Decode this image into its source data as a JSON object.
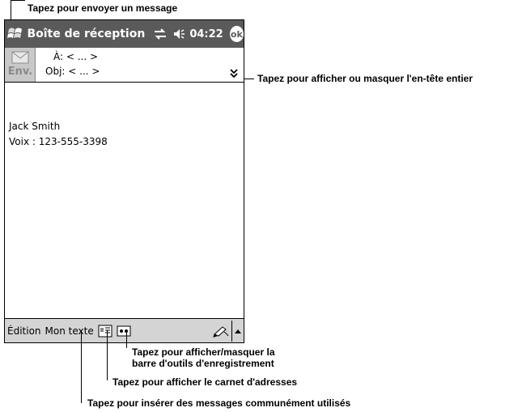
{
  "callouts": {
    "send": "Tapez pour envoyer un message",
    "header_toggle": "Tapez pour afficher ou masquer l'en-tête entier",
    "recording_line1": "Tapez pour afficher/masquer la",
    "recording_line2": "barre d'outils d'enregistrement",
    "address_book": "Tapez pour afficher le carnet d'adresses",
    "my_text": "Tapez pour insérer des messages communément utilisés"
  },
  "titlebar": {
    "title": "Boîte de réception",
    "time": "04:22",
    "ok_label": "ok"
  },
  "header": {
    "send_label": "Env.",
    "to_field": "À: < ... >",
    "subject_field": "Obj: < ... >"
  },
  "body": {
    "line1": "Jack Smith",
    "line2": "Voix : 123-555-3398"
  },
  "bottombar": {
    "edit_menu": "Édition",
    "my_text_menu": "Mon texte"
  }
}
